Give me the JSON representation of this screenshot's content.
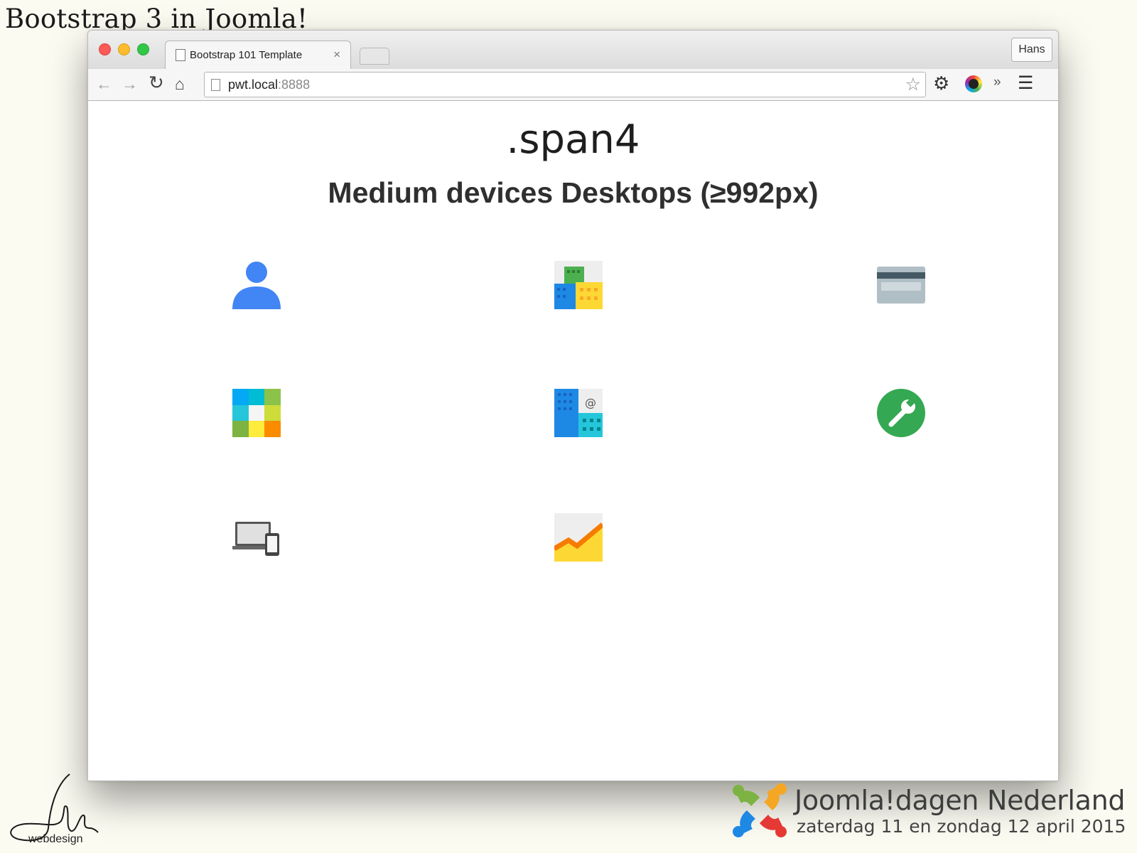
{
  "slide": {
    "title": "Bootstrap 3 in Joomla!"
  },
  "browser": {
    "tab_title": "Bootstrap 101 Template",
    "tab_close": "×",
    "profile_name": "Hans",
    "url_host": "pwt.local",
    "url_port": ":8888"
  },
  "page": {
    "heading": ".span4",
    "subheading": "Medium devices Desktops (≥992px)",
    "icons": [
      "user-icon",
      "buildings-icon",
      "credit-card-icon",
      "apps-grid-icon",
      "directory-icon",
      "wrench-icon",
      "devices-icon",
      "analytics-icon"
    ]
  },
  "footer": {
    "signature_label": "webdesign",
    "event_name": "Joomla!dagen Nederland",
    "event_date": "zaterdag 11 en zondag 12 april 2015"
  }
}
